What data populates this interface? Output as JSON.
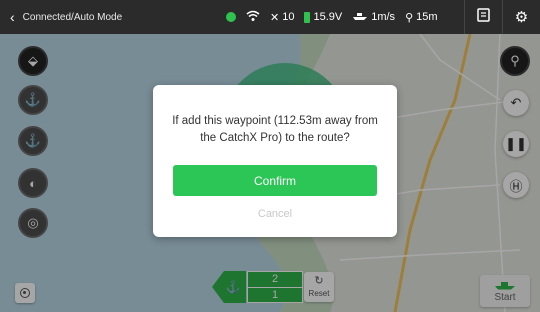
{
  "topbar": {
    "mode": "Connected/Auto Mode",
    "satellites": "10",
    "voltage": "15.9V",
    "speed": "1m/s",
    "depth": "15m",
    "log_label": "LOG"
  },
  "dialog": {
    "message": "If add this waypoint (112.53m away from the CatchX Pro) to the route?",
    "confirm_label": "Confirm",
    "cancel_label": "Cancel"
  },
  "waypoints": {
    "top": "2",
    "bottom": "1"
  },
  "reset_label": "Reset",
  "start_label": "Start",
  "colors": {
    "accent_green": "#2bc655",
    "topbar": "#2b2b2b",
    "water": "#b9d7e6",
    "land": "#e4e6e0"
  },
  "icons": {
    "left": [
      "route-icon",
      "anchor-boat-icon",
      "anchor-person-icon",
      "light-icon",
      "sonar-icon"
    ],
    "right": [
      "location-pin-icon",
      "return-icon",
      "pause-icon",
      "home-icon"
    ]
  }
}
